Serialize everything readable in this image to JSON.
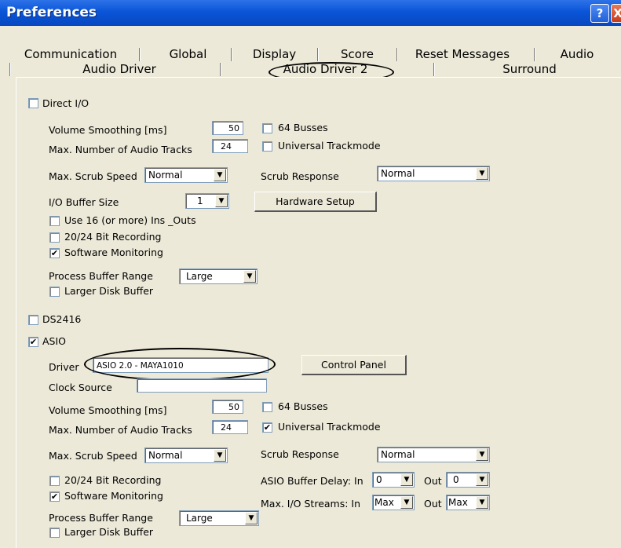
{
  "window": {
    "title": "Preferences",
    "help_glyph": "?",
    "close_glyph": "X"
  },
  "tabs": {
    "row1": [
      "Communication",
      "Global",
      "Display",
      "Score",
      "Reset Messages",
      "Audio"
    ],
    "row2": [
      "Audio Driver",
      "Audio Driver 2",
      "Surround"
    ],
    "active": "Audio Driver 2"
  },
  "direct_io": {
    "label": "Direct I/O",
    "checked": false,
    "volume_smoothing_label": "Volume Smoothing [ms]",
    "volume_smoothing": "50",
    "max_tracks_label": "Max. Number of Audio Tracks",
    "max_tracks": "24",
    "busses_label": "64 Busses",
    "busses": false,
    "universal_label": "Universal Trackmode",
    "universal": false,
    "scrub_speed_label": "Max. Scrub Speed",
    "scrub_speed": "Normal",
    "scrub_response_label": "Scrub Response",
    "scrub_response": "Normal",
    "io_buffer_label": "I/O Buffer Size",
    "io_buffer": "1",
    "hardware_setup": "Hardware Setup",
    "use16_label": "Use 16 (or more) Ins _Outs",
    "use16": false,
    "bit_recording_label": "20/24 Bit Recording",
    "bit_recording": false,
    "software_monitoring_label": "Software Monitoring",
    "software_monitoring": true,
    "process_buffer_label": "Process Buffer Range",
    "process_buffer": "Large",
    "larger_disk_label": "Larger Disk Buffer",
    "larger_disk": false
  },
  "ds2416": {
    "label": "DS2416",
    "checked": false
  },
  "asio": {
    "label": "ASIO",
    "checked": true,
    "driver_label": "Driver",
    "driver": "ASIO 2.0 - MAYA1010",
    "control_panel": "Control Panel",
    "clock_source_label": "Clock Source",
    "clock_source": "",
    "volume_smoothing_label": "Volume Smoothing [ms]",
    "volume_smoothing": "50",
    "max_tracks_label": "Max. Number of Audio Tracks",
    "max_tracks": "24",
    "busses_label": "64 Busses",
    "busses": false,
    "universal_label": "Universal Trackmode",
    "universal": true,
    "scrub_speed_label": "Max. Scrub Speed",
    "scrub_speed": "Normal",
    "scrub_response_label": "Scrub Response",
    "scrub_response": "Normal",
    "bit_recording_label": "20/24 Bit Recording",
    "bit_recording": false,
    "software_monitoring_label": "Software Monitoring",
    "software_monitoring": true,
    "buffer_delay_label": "ASIO Buffer Delay:  In",
    "buffer_delay_in": "0",
    "out_label": "Out",
    "buffer_delay_out": "0",
    "io_streams_label": "Max. I/O Streams:  In",
    "io_streams_in": "Max",
    "io_streams_out": "Max",
    "process_buffer_label": "Process Buffer Range",
    "process_buffer": "Large",
    "larger_disk_label": "Larger Disk Buffer",
    "larger_disk": false
  },
  "check_glyph": "✔",
  "arrow_glyph": "▼"
}
